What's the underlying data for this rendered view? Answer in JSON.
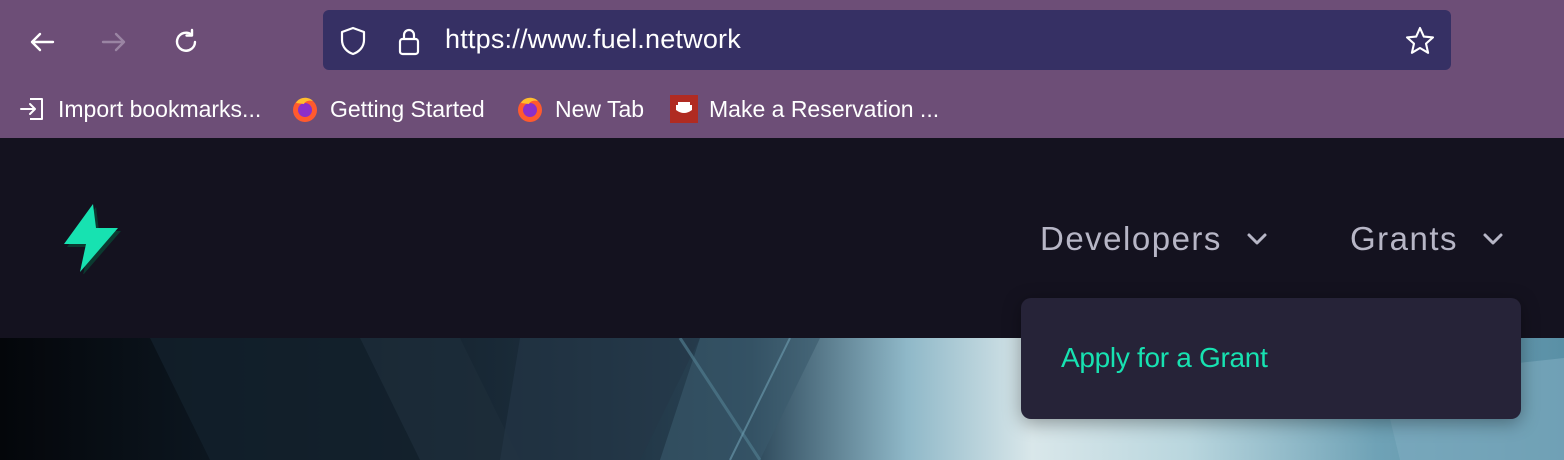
{
  "browser": {
    "url": "https://www.fuel.network",
    "bookmarks": [
      {
        "label": "Import bookmarks...",
        "icon": "import-icon"
      },
      {
        "label": "Getting Started",
        "icon": "firefox-icon"
      },
      {
        "label": "New Tab",
        "icon": "firefox-icon"
      },
      {
        "label": "Make a Reservation ...",
        "icon": "reservation-icon"
      }
    ],
    "colors": {
      "toolbar": "#6d4e77",
      "urlbar": "#363064"
    }
  },
  "site": {
    "logo_icon": "lightning-bolt-icon",
    "nav": [
      {
        "label": "Developers",
        "icon": "chevron-down-icon"
      },
      {
        "label": "Grants",
        "icon": "chevron-down-icon"
      }
    ],
    "dropdown": {
      "items": [
        {
          "label": "Apply for a Grant"
        }
      ]
    },
    "colors": {
      "background": "#14121f",
      "accent": "#17e2b1",
      "nav_text": "#b7b6c6",
      "dropdown_bg": "#262338"
    }
  }
}
